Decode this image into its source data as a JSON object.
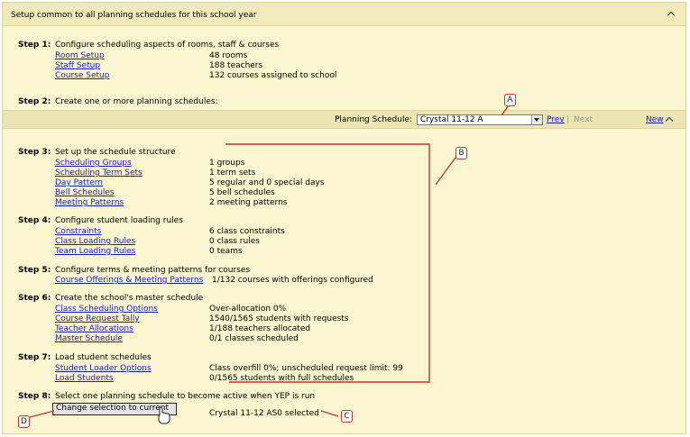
{
  "header": {
    "title": "Setup common to all planning schedules for this school year"
  },
  "step1": {
    "label": "Step 1:",
    "text": "Configure scheduling aspects of rooms, staff & courses",
    "rows": [
      {
        "link": "Room Setup",
        "value": "48 rooms"
      },
      {
        "link": "Staff Setup",
        "value": "188 teachers"
      },
      {
        "link": "Course Setup",
        "value": "132 courses assigned to school"
      }
    ]
  },
  "step2": {
    "label": "Step 2:",
    "text": "Create one or more planning schedules:"
  },
  "planning": {
    "label": "Planning Schedule:",
    "selected": "Crystal 11-12 A",
    "prev": "Prev",
    "separator": "|",
    "next": "Next",
    "new": "New"
  },
  "step3": {
    "label": "Step 3:",
    "text": "Set up the schedule structure",
    "rows": [
      {
        "link": "Scheduling Groups",
        "value": "1 groups"
      },
      {
        "link": "Scheduling Term Sets",
        "value": "1 term sets"
      },
      {
        "link": "Day Pattern",
        "value": "5 regular and 0 special days"
      },
      {
        "link": "Bell Schedules",
        "value": "5 bell schedules"
      },
      {
        "link": "Meeting Patterns",
        "value": "2 meeting patterns"
      }
    ]
  },
  "step4": {
    "label": "Step 4:",
    "text": "Configure student loading rules",
    "rows": [
      {
        "link": "Constraints",
        "value": "6 class constraints"
      },
      {
        "link": "Class Loading Rules",
        "value": "0 class rules"
      },
      {
        "link": "Team Loading Rules",
        "value": "0 teams"
      }
    ]
  },
  "step5": {
    "label": "Step 5:",
    "text": "Configure terms & meeting patterns for courses",
    "rows": [
      {
        "link": "Course Offerings & Meeting Patterns",
        "value": "1/132 courses with offerings configured"
      }
    ]
  },
  "step6": {
    "label": "Step 6:",
    "text": "Create the school's master schedule",
    "rows": [
      {
        "link": "Class Scheduling Options",
        "value": "Over-allocation 0%"
      },
      {
        "link": "Course Request Tally",
        "value": "1540/1565 students with requests"
      },
      {
        "link": "Teacher Allocations",
        "value": "1/188 teachers allocated"
      },
      {
        "link": "Master Schedule",
        "value": "0/1 classes scheduled"
      }
    ]
  },
  "step7": {
    "label": "Step 7:",
    "text": "Load student schedules",
    "rows": [
      {
        "link": "Student Loader Options",
        "value": "Class overfill 0%; unscheduled request limit: 99"
      },
      {
        "link": "Load Students",
        "value": "0/1565 students with full schedules"
      }
    ]
  },
  "step8": {
    "label": "Step 8:",
    "text": "Select one planning schedule to become active when YEP is run",
    "button": "Change selection to current",
    "status": "Crystal 11-12 AS0 selected"
  },
  "callouts": {
    "a": "A",
    "b": "B",
    "c": "C",
    "d": "D"
  },
  "colors": {
    "panel": "#fbf6d0",
    "bar": "#ece5b4",
    "link": "#1a1ab8",
    "callout": "#c0392b",
    "next_disabled": "#9a9a9a"
  },
  "icons": {
    "collapse": "caret-up-icon",
    "dropdown": "chevron-down-icon",
    "cursor": "hand-pointer-icon"
  }
}
